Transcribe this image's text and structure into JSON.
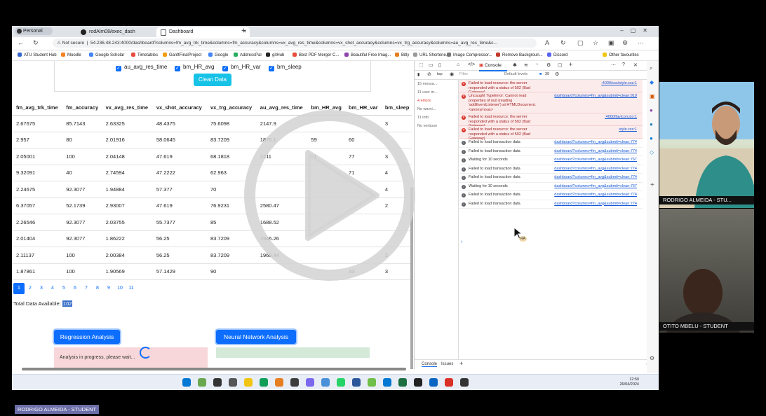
{
  "browser": {
    "profile": "Personal",
    "tabs": [
      {
        "label": "rodAlm08/exec_dash",
        "active": false
      },
      {
        "label": "Dashboard",
        "active": true
      }
    ],
    "security": "Not secure",
    "url": "54.236.48.243:4000/dashboard?columns=fm_avg_trk_time&columns=fm_accuracy&columns=vx_avg_res_time&columns=vx_shot_accuracy&columns=vx_trg_accuracy&columns=au_avg_res_time&c...",
    "bookmarks": [
      "ATU Student Hub",
      "Moodle",
      "Google Scholar",
      "Timetables",
      "GanttFinalProject",
      "Google",
      "AddressPal",
      "gitHub",
      "Best PDF Merger C...",
      "Beautiful Free Imag...",
      "Bitly",
      "URL Shortene...",
      "Image Compressor...",
      "Remove Backgroun...",
      "Discord",
      "Other favourites"
    ]
  },
  "filters": {
    "checkboxes": [
      "au_avg_res_time",
      "bm_HR_avg",
      "bm_HR_var",
      "bm_sleep"
    ],
    "clean_button": "Clean Data"
  },
  "table": {
    "headers": [
      "fm_avg_trk_time",
      "fm_accuracy",
      "vx_avg_res_time",
      "vx_shot_accuracy",
      "vx_trg_accuracy",
      "au_avg_res_time",
      "bm_HR_avg",
      "bm_HR_var",
      "bm_sleep"
    ],
    "rows": [
      [
        "2.67675",
        "85.7143",
        "2.63325",
        "48.4375",
        "75.6098",
        "2147.9",
        "",
        "",
        "3"
      ],
      [
        "2.957",
        "80",
        "2.01916",
        "58.0645",
        "83.7209",
        "1875.1",
        "59",
        "60",
        ""
      ],
      [
        "2.05001",
        "100",
        "2.04148",
        "47.619",
        "68.1818",
        "2211",
        "61",
        "77",
        "3"
      ],
      [
        "9.32091",
        "40",
        "2.74594",
        "47.2222",
        "62.963",
        "",
        "",
        "71",
        "4"
      ],
      [
        "2.24675",
        "92.3077",
        "1.94884",
        "57.377",
        "70",
        "",
        "",
        "",
        "4"
      ],
      [
        "6.37057",
        "52.1739",
        "2.93007",
        "47.619",
        "76.9231",
        "2580.47",
        "",
        "",
        "2"
      ],
      [
        "2.26546",
        "92.3077",
        "2.03755",
        "55.7377",
        "85",
        "1688.52",
        "",
        "",
        ""
      ],
      [
        "2.01404",
        "92.3077",
        "1.86222",
        "56.25",
        "83.7209",
        "1946.26",
        "",
        "",
        ""
      ],
      [
        "2.11137",
        "100",
        "2.00384",
        "56.25",
        "83.7209",
        "1968.44",
        "",
        "",
        "2"
      ],
      [
        "1.87861",
        "100",
        "1.90569",
        "57.1429",
        "90",
        "",
        "",
        "33",
        "3"
      ]
    ]
  },
  "pagination": [
    "1",
    "2",
    "3",
    "4",
    "5",
    "6",
    "7",
    "8",
    "9",
    "10",
    "11"
  ],
  "total": {
    "label": "Total Data Available:",
    "value": "102"
  },
  "regression": {
    "button": "Regression Analysis",
    "status": "Analysis in progress, please wait..."
  },
  "neural": {
    "button": "Neural Network Analysis"
  },
  "devtools": {
    "tabs": [
      "Console"
    ],
    "context": "top",
    "filter_placeholder": "Filter",
    "levels": "Default levels",
    "issues_count": "39",
    "sidebar": [
      "15 messa...",
      "11 user m...",
      "4 errors",
      "No warni...",
      "11 info",
      "No verbose"
    ],
    "messages": [
      {
        "type": "err",
        "text": "Failed to load resource: the server responded with a status of 502 (Bad Gateway)",
        "src": ":4000/css/style.css:1"
      },
      {
        "type": "err",
        "text": "Uncaught TypeError: Cannot read properties of null (reading 'addEventListener') at HTMLDocument.<anonymous>",
        "src": "dashboard?columns=fm_avg&submit=clean:919"
      },
      {
        "type": "err",
        "text": "Failed to load resource: the server responded with a status of 502 (Bad Gateway)",
        "src": ":4000/favicon.ico:1"
      },
      {
        "type": "err",
        "text": "Failed to load resource: the server responded with a status of 502 (Bad Gateway)",
        "src": "style.css:1"
      },
      {
        "type": "log",
        "text": "Failed to load transaction data",
        "src": "dashboard?columns=fm_avg&submit=clean:774"
      },
      {
        "type": "log",
        "text": "Failed to load transaction data",
        "src": "dashboard?columns=fm_avg&submit=clean:774"
      },
      {
        "type": "log",
        "text": "Waiting for 10 seconds",
        "src": "dashboard?columns=fm_avg&submit=clean:767"
      },
      {
        "type": "log",
        "text": "Failed to load transaction data",
        "src": "dashboard?columns=fm_avg&submit=clean:774"
      },
      {
        "type": "log",
        "text": "Failed to load transaction data",
        "src": "dashboard?columns=fm_avg&submit=clean:774"
      },
      {
        "type": "log",
        "text": "Waiting for 10 seconds",
        "src": "dashboard?columns=fm_avg&submit=clean:767"
      },
      {
        "type": "log",
        "text": "Failed to load transaction data",
        "src": "dashboard?columns=fm_avg&submit=clean:774"
      },
      {
        "type": "log",
        "text": "Failed to load transaction data",
        "src": "dashboard?columns=fm_avg&submit=clean:774"
      }
    ],
    "bottom_tabs": [
      "Console",
      "Issues"
    ]
  },
  "taskbar": {
    "time": "12:50",
    "date": "26/04/2024"
  },
  "participants": [
    {
      "name": "RODRIGO ALMEIDA - STU..."
    },
    {
      "name": "OTITO MBELU - STUDENT"
    }
  ],
  "presenter_label": "RODRIGO ALMEIDA - STUDENT",
  "cursor_label": "RA"
}
